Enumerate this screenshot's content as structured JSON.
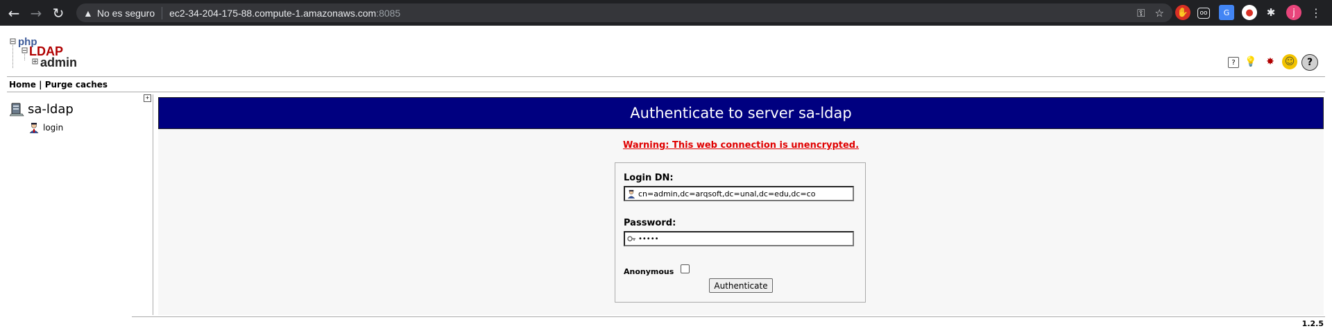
{
  "browser": {
    "security_label": "No es seguro",
    "host": "ec2-34-204-175-88.compute-1.amazonaws.com",
    "port": ":8085",
    "profile_initial": "j"
  },
  "logo": {
    "php": "php",
    "ldap": "LDAP",
    "admin": "admin"
  },
  "menu": {
    "home": "Home",
    "separator": "|",
    "purge": "Purge caches"
  },
  "tree": {
    "server": "sa-ldap",
    "login": "login"
  },
  "main": {
    "title": "Authenticate to server sa-ldap",
    "warning": "Warning: This web connection is unencrypted.",
    "login_dn_label": "Login DN:",
    "login_dn_value": "cn=admin,dc=arqsoft,dc=unal,dc=edu,dc=co",
    "password_label": "Password:",
    "password_value": "•••••",
    "anonymous_label": "Anonymous",
    "authenticate_label": "Authenticate"
  },
  "footer": {
    "version": "1.2.5"
  },
  "colors": {
    "title_bg": "#000080",
    "warning": "#e00000",
    "chrome_bg": "#202124"
  }
}
